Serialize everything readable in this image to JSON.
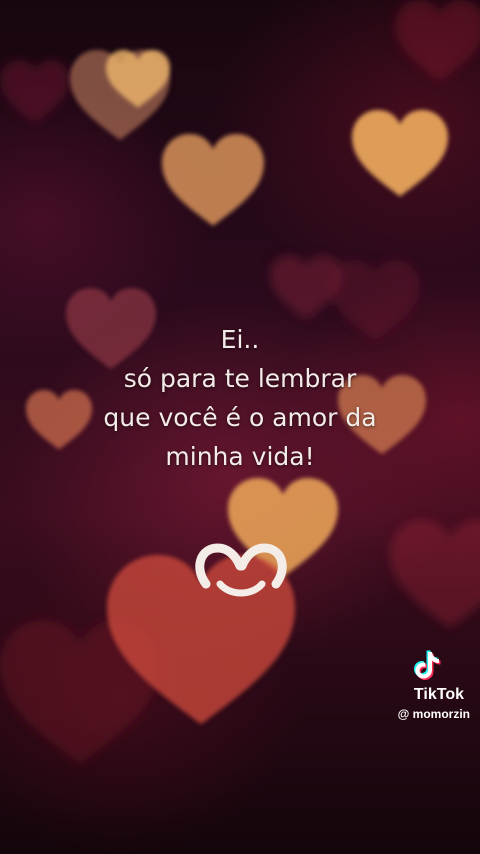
{
  "message": {
    "lines": [
      "Ei..",
      "só para te lembrar",
      "que você é o amor da",
      "minha vida!"
    ]
  },
  "watermark": {
    "brand": "TikTok",
    "username": "@ momorzin",
    "icon": "tiktok-note-icon"
  },
  "decor": {
    "icon": "smiling-heart-logo-icon",
    "background_icon": "heart-icon"
  },
  "colors": {
    "text": "#f3ece9",
    "heart_gold": "#e8a85c",
    "heart_red": "#c23a38",
    "background": "#1a0612"
  }
}
